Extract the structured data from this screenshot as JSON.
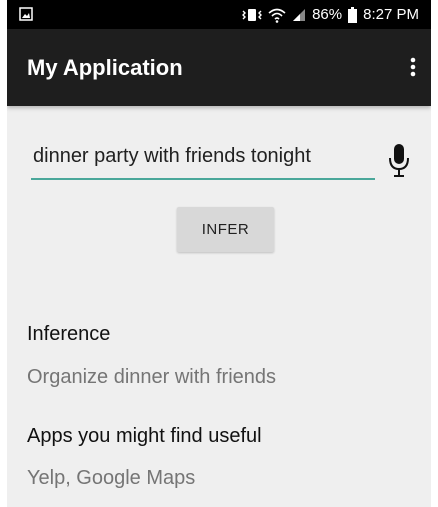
{
  "status_bar": {
    "battery_percent": "86%",
    "time": "8:27 PM",
    "icons": [
      "image-icon",
      "vibrate-icon",
      "wifi-icon",
      "signal-icon",
      "battery-icon"
    ]
  },
  "app_bar": {
    "title": "My Application",
    "overflow_icon": "more-vert-icon"
  },
  "query": {
    "value": "dinner party with friends tonight",
    "mic_icon": "microphone-icon"
  },
  "infer_button": {
    "label": "INFER"
  },
  "inference": {
    "label": "Inference",
    "value": "Organize dinner with friends"
  },
  "apps": {
    "label": "Apps you might find useful",
    "value": "Yelp, Google Maps"
  },
  "colors": {
    "app_bar": "#1e1e1e",
    "status_bar": "#000000",
    "accent": "#4aa79a",
    "background": "#efefef",
    "button": "#d8d8d8"
  }
}
